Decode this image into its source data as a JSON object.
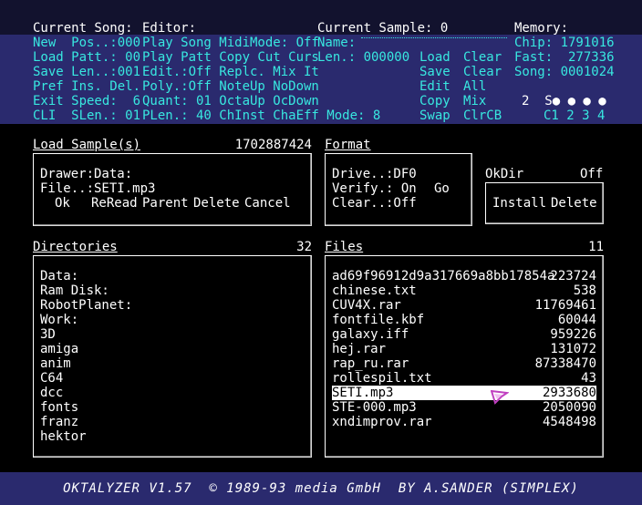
{
  "top": {
    "col1": [
      {
        "text": "Current Song:",
        "white": true
      },
      {
        "text": "New  Pos..:000"
      },
      {
        "text": "Load Patt.: 00"
      },
      {
        "text": "Save Len..:001"
      },
      {
        "text": "Pref Ins. Del."
      },
      {
        "text": "Exit Speed:  6"
      },
      {
        "text": "CLI  SLen.: 01"
      }
    ],
    "col2": [
      {
        "text": "Editor:",
        "white": true
      },
      {
        "text": "Play Song MidiMode: Off"
      },
      {
        "text": "Play Patt Copy Cut Curs"
      },
      {
        "text": "Edit.:Off Replc. Mix It"
      },
      {
        "text": "Poly.:Off NoteUp NoDown"
      },
      {
        "text": "Quant: 01 OctaUp OcDown"
      },
      {
        "text": "PLen.: 40 ChInst ChaEff Mode: 8"
      }
    ],
    "col3": [
      {
        "text": "Current Sample: 0",
        "white": true
      },
      {
        "text": "Name:"
      },
      {
        "text": "Len.: 000000"
      }
    ],
    "col4": [
      {
        "text": "Load"
      },
      {
        "text": "Save"
      },
      {
        "text": "Edit"
      },
      {
        "text": "Copy"
      },
      {
        "text": "Swap"
      }
    ],
    "col5": [
      {
        "text": "Clear"
      },
      {
        "text": "Clear"
      },
      {
        "text": "All"
      },
      {
        "text": "Mix"
      },
      {
        "text": "ClrCB"
      }
    ],
    "memory": [
      {
        "text": "Memory:",
        "white": true
      },
      {
        "text": "Chip: 1791016"
      },
      {
        "text": "Fast:  277336"
      },
      {
        "text": "Song: 0001024"
      }
    ],
    "channels": {
      "row1": "2  S● ● ● ●",
      "row2": "C1 2 3 4"
    }
  },
  "load_sample": {
    "title": "Load Sample(s)",
    "free_bytes": "1702887424",
    "drawer": "Drawer:Data:",
    "file": "File..:SETI.mp3",
    "buttons": [
      "Ok",
      "ReRead",
      "Parent",
      "Delete",
      "Cancel"
    ]
  },
  "format": {
    "title": "Format",
    "drive": "Drive..:DF0",
    "verify": "Verify.: On",
    "clear": "Clear..:Off",
    "go": "Go"
  },
  "okdir": {
    "label": "OkDir",
    "value": "Off",
    "install": "Install",
    "delete": "Delete"
  },
  "directories": {
    "title": "Directories",
    "count": "32",
    "items": [
      "Data:",
      "Ram Disk:",
      "RobotPlanet:",
      "Work:",
      "3D",
      "amiga",
      "anim",
      "C64",
      "dcc",
      "fonts",
      "franz",
      "hektor"
    ]
  },
  "files": {
    "title": "Files",
    "count": "11",
    "items": [
      {
        "name": "ad69f96912d9a317669a8bb17854a",
        "size": "223724"
      },
      {
        "name": "chinese.txt",
        "size": "538"
      },
      {
        "name": "CUV4X.rar",
        "size": "11769461"
      },
      {
        "name": "fontfile.kbf",
        "size": "60044"
      },
      {
        "name": "galaxy.iff",
        "size": "959226"
      },
      {
        "name": "hej.rar",
        "size": "131072"
      },
      {
        "name": "rap_ru.rar",
        "size": "87338470"
      },
      {
        "name": "rollespil.txt",
        "size": "43"
      },
      {
        "name": "SETI.mp3",
        "size": "2933680",
        "selected": true
      },
      {
        "name": "STE-000.mp3",
        "size": "2050090"
      },
      {
        "name": "xndimprov.rar",
        "size": "4548498"
      }
    ]
  },
  "footer": {
    "credits": "OKTALYZER V1.57  © 1989-93 media GmbH  BY A.SANDER (SIMPLEX)"
  },
  "colors": {
    "accent": "#38e8e0",
    "panel": "#2a2a6e",
    "background": "#000000"
  }
}
